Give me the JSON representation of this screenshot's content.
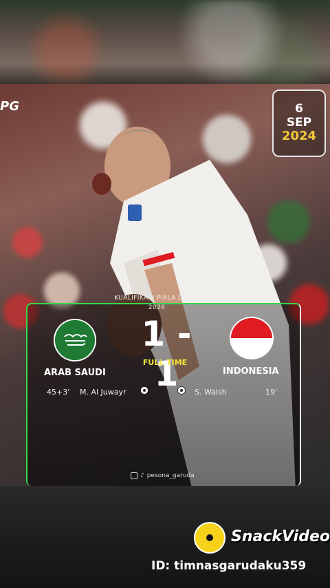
{
  "poster": {
    "brand_logo": "PG",
    "date": {
      "day": "6",
      "month": "SEP",
      "year": "2024"
    },
    "competition_line1": "KUALIFIKASI PIALA DUNIA",
    "competition_line2": "2026",
    "score": "1 - 1",
    "status": "FULL TIME",
    "home_team": "ARAB SAUDI",
    "away_team": "INDONESIA",
    "home_event_time": "45+3'",
    "home_event_player": "M. Al Juwayr",
    "away_event_player": "S. Walsh",
    "away_event_time": "19'",
    "social_handle": "pesona_garuda"
  },
  "watermark": {
    "app_name": "SnackVideo",
    "id_text": "ID: timnasgarudaku359"
  },
  "colors": {
    "accent_green": "#35d84a",
    "accent_yellow": "#f3e23a",
    "date_year": "#f3c93a",
    "indonesia_red": "#e11b22"
  }
}
